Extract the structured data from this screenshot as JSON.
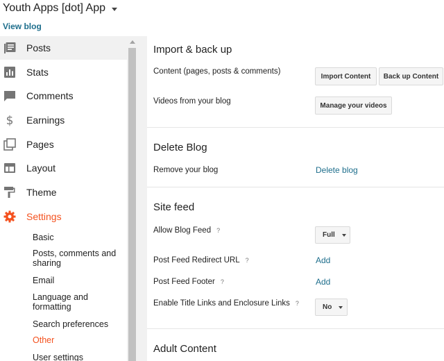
{
  "header": {
    "blog_title": "Youth Apps [dot] App",
    "view_blog": "View blog"
  },
  "sidebar": {
    "items": [
      {
        "label": "Posts",
        "icon": "posts-icon"
      },
      {
        "label": "Stats",
        "icon": "stats-icon"
      },
      {
        "label": "Comments",
        "icon": "comments-icon"
      },
      {
        "label": "Earnings",
        "icon": "dollar-icon"
      },
      {
        "label": "Pages",
        "icon": "pages-icon"
      },
      {
        "label": "Layout",
        "icon": "layout-icon"
      },
      {
        "label": "Theme",
        "icon": "paint-roller-icon"
      },
      {
        "label": "Settings",
        "icon": "gear-icon"
      }
    ],
    "settings_sub": [
      "Basic",
      "Posts, comments and sharing",
      "Email",
      "Language and formatting",
      "Search preferences",
      "Other",
      "User settings"
    ]
  },
  "import_backup": {
    "title": "Import & back up",
    "content_label": "Content (pages, posts & comments)",
    "import_btn": "Import Content",
    "backup_btn": "Back up Content",
    "videos_label": "Videos from your blog",
    "manage_btn": "Manage your videos"
  },
  "delete_blog": {
    "title": "Delete Blog",
    "remove_label": "Remove your blog",
    "delete_link": "Delete blog"
  },
  "site_feed": {
    "title": "Site feed",
    "allow_label": "Allow Blog Feed",
    "allow_value": "Full",
    "redirect_label": "Post Feed Redirect URL",
    "redirect_link": "Add",
    "footer_label": "Post Feed Footer",
    "footer_link": "Add",
    "title_links_label": "Enable Title Links and Enclosure Links",
    "title_links_value": "No",
    "help_glyph": "?"
  },
  "adult": {
    "title": "Adult Content"
  },
  "colors": {
    "accent": "#f4511e",
    "link": "#1e6e8c"
  }
}
